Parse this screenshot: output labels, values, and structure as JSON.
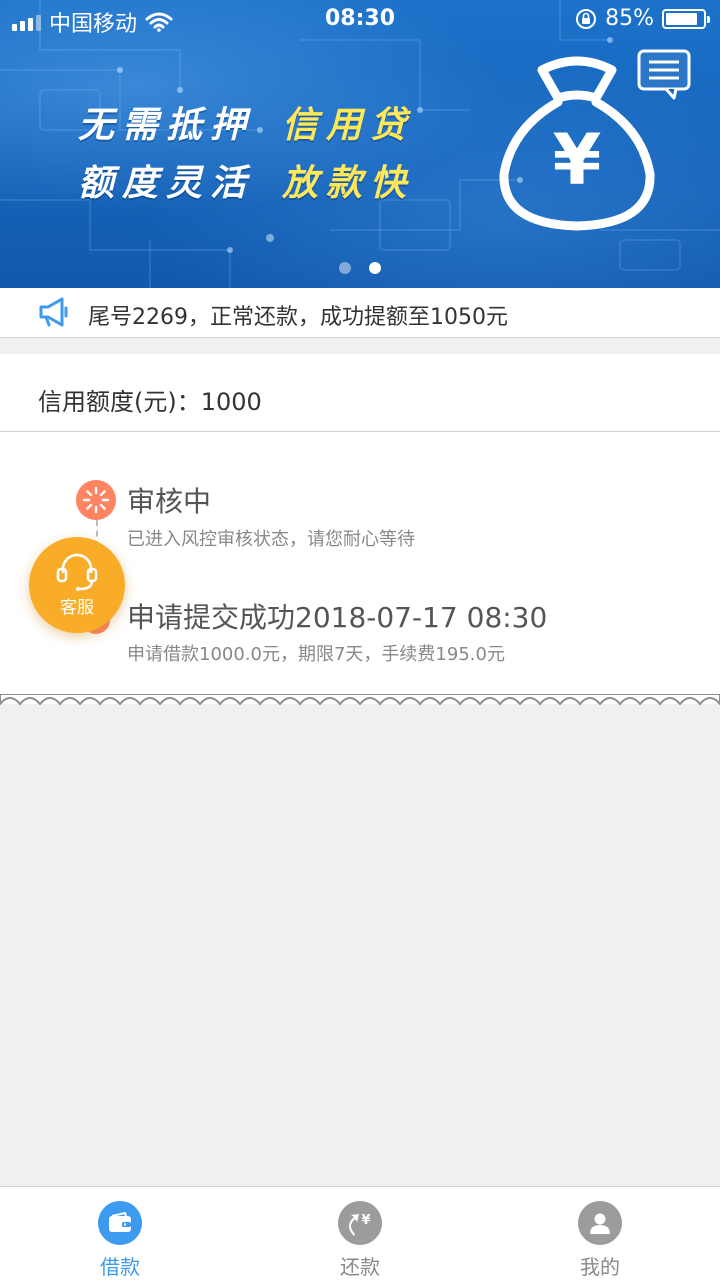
{
  "status_bar": {
    "carrier": "中国移动",
    "time": "08:30",
    "battery_percent": 85,
    "battery_label": "85%",
    "icons": [
      "signal-icon",
      "wifi-icon",
      "rotation-lock-icon",
      "battery-icon"
    ]
  },
  "banner": {
    "line1_white": "无需抵押",
    "line1_yellow": "信用贷",
    "line2_white": "额度灵活",
    "line2_yellow": "放款快",
    "currency_symbol": "¥",
    "carousel_total": 2,
    "carousel_active": 2,
    "colors": {
      "background": "#1767be",
      "highlight": "#ffe75a"
    }
  },
  "notice": {
    "text": "尾号2269，正常还款，成功提额至1050元",
    "icon": "megaphone-icon"
  },
  "credit": {
    "text": "信用额度(元)：1000"
  },
  "timeline": [
    {
      "title": "审核中",
      "subtitle": "已进入风控审核状态，请您耐心等待",
      "icon": "loading-spinner-icon"
    },
    {
      "title": "申请提交成功2018-07-17 08:30",
      "subtitle": "申请借款1000.0元，期限7天，手续费195.0元",
      "icon": "dot-icon"
    }
  ],
  "service": {
    "label": "客服",
    "icon": "headset-icon",
    "color": "#f8ac28"
  },
  "tabs": [
    {
      "label": "借款",
      "icon": "wallet-icon",
      "active": true
    },
    {
      "label": "还款",
      "icon": "repay-yen-icon",
      "active": false
    },
    {
      "label": "我的",
      "icon": "user-icon",
      "active": false
    }
  ],
  "colors": {
    "accent": "#3c9bee",
    "timeline_dot": "#ff8462",
    "inactive_tab": "#9c9c9c"
  }
}
